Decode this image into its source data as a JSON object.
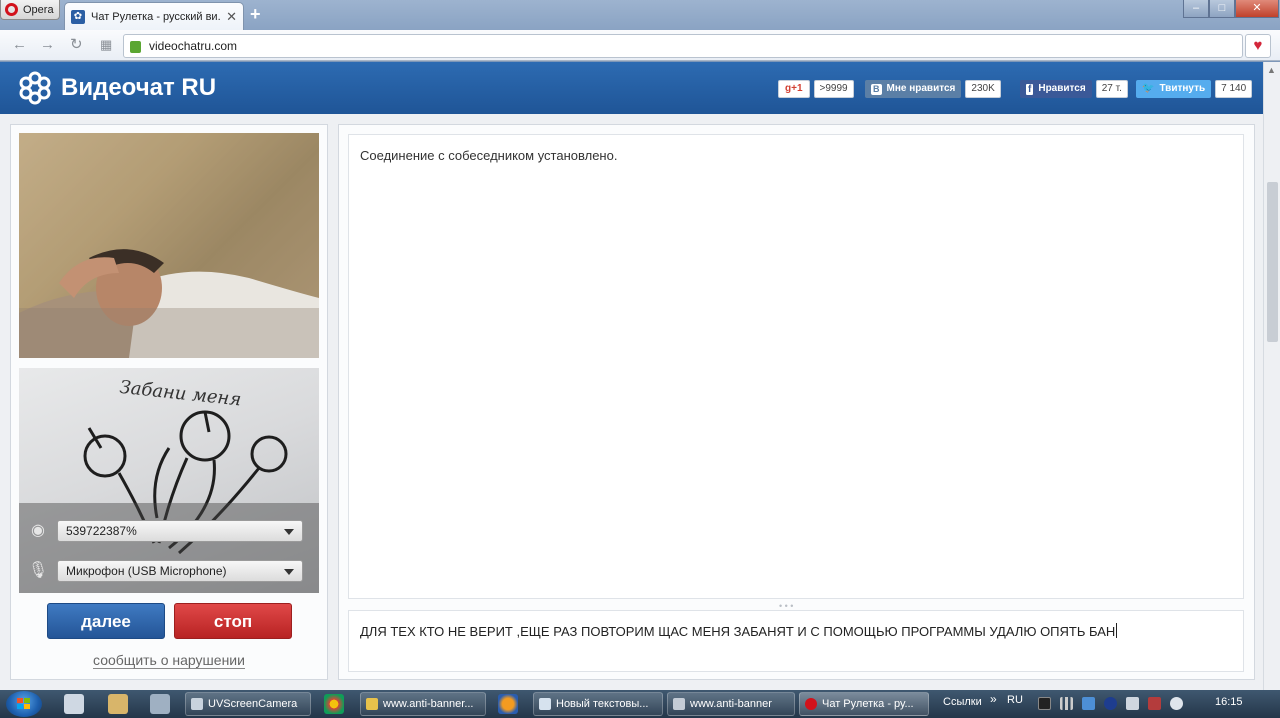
{
  "browser": {
    "menu_label": "Opera",
    "tab_title": "Чат Рулетка - русский ви...",
    "tab_favicon": "videochat-logo-icon",
    "new_tab": "+",
    "address": "videochatru.com",
    "window_controls": {
      "minimize": "–",
      "maximize": "□",
      "close": "✕"
    }
  },
  "site": {
    "logo_text": "Видеочат RU",
    "social": {
      "gplus": {
        "label": "g+1",
        "count": ">9999"
      },
      "vk": {
        "badge": "B",
        "label": "Мне нравится",
        "count": "230K"
      },
      "facebook": {
        "badge": "f",
        "label": "Нравится",
        "count": "27 т."
      },
      "twitter": {
        "label": "Твитнуть",
        "count": "7 140"
      }
    },
    "devices": {
      "camera": "539722387%",
      "microphone": "Микрофон (USB Microphone)"
    },
    "self_video_caption": "Забани меня",
    "buttons": {
      "next": "далее",
      "stop": "стоп"
    },
    "report_link": "сообщить о нарушении",
    "chat": {
      "messages": [
        "Соединение с собеседником установлено."
      ],
      "input_value": "ДЛЯ ТЕХ КТО НЕ ВЕРИТ ,ЕЩЕ РАЗ ПОВТОРИМ ЩАС МЕНЯ ЗАБАНЯТ И С ПОМОЩЬЮ ПРОГРАММЫ УДАЛЮ ОПЯТЬ БАН"
    },
    "colors": {
      "brand_blue": "#2d6bb2",
      "next_button": "#245597",
      "stop_button": "#b82323"
    }
  },
  "taskbar": {
    "items": [
      {
        "label": "UVScreenCamera"
      },
      {
        "label": "www.anti-banner..."
      },
      {
        "label": "Новый текстовы..."
      },
      {
        "label": "www.anti-banner"
      },
      {
        "label": "Чат Рулетка - ру..."
      }
    ],
    "links_label": "Ссылки",
    "links_chevron": "»",
    "lang": "RU",
    "clock": "16:15"
  }
}
